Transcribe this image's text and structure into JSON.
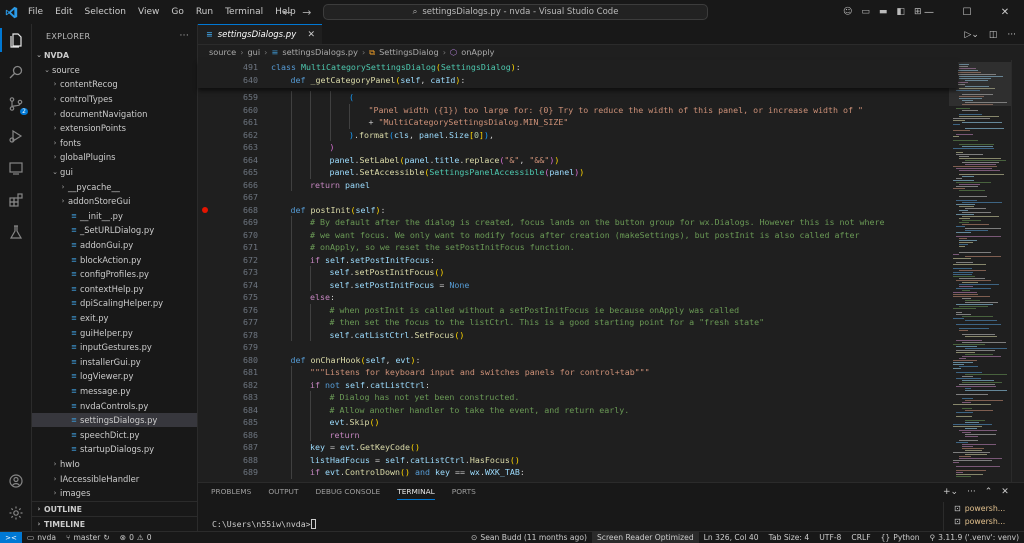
{
  "menu": [
    "File",
    "Edit",
    "Selection",
    "View",
    "Go",
    "Run",
    "Terminal",
    "Help"
  ],
  "search": {
    "text": "settingsDialogs.py - nvda - Visual Studio Code"
  },
  "explorer": {
    "title": "EXPLORER",
    "root": "NVDA",
    "items": [
      {
        "label": "source",
        "indent": 1,
        "type": "folder",
        "open": true
      },
      {
        "label": "contentRecog",
        "indent": 2,
        "type": "folder"
      },
      {
        "label": "controlTypes",
        "indent": 2,
        "type": "folder"
      },
      {
        "label": "documentNavigation",
        "indent": 2,
        "type": "folder"
      },
      {
        "label": "extensionPoints",
        "indent": 2,
        "type": "folder"
      },
      {
        "label": "fonts",
        "indent": 2,
        "type": "folder"
      },
      {
        "label": "globalPlugins",
        "indent": 2,
        "type": "folder"
      },
      {
        "label": "gui",
        "indent": 2,
        "type": "folder",
        "open": true
      },
      {
        "label": "__pycache__",
        "indent": 3,
        "type": "folder"
      },
      {
        "label": "addonStoreGui",
        "indent": 3,
        "type": "folder"
      },
      {
        "label": "__init__.py",
        "indent": 3,
        "type": "py"
      },
      {
        "label": "_SetURLDialog.py",
        "indent": 3,
        "type": "py"
      },
      {
        "label": "addonGui.py",
        "indent": 3,
        "type": "py"
      },
      {
        "label": "blockAction.py",
        "indent": 3,
        "type": "py"
      },
      {
        "label": "configProfiles.py",
        "indent": 3,
        "type": "py"
      },
      {
        "label": "contextHelp.py",
        "indent": 3,
        "type": "py"
      },
      {
        "label": "dpiScalingHelper.py",
        "indent": 3,
        "type": "py"
      },
      {
        "label": "exit.py",
        "indent": 3,
        "type": "py"
      },
      {
        "label": "guiHelper.py",
        "indent": 3,
        "type": "py"
      },
      {
        "label": "inputGestures.py",
        "indent": 3,
        "type": "py"
      },
      {
        "label": "installerGui.py",
        "indent": 3,
        "type": "py"
      },
      {
        "label": "logViewer.py",
        "indent": 3,
        "type": "py"
      },
      {
        "label": "message.py",
        "indent": 3,
        "type": "py"
      },
      {
        "label": "nvdaControls.py",
        "indent": 3,
        "type": "py"
      },
      {
        "label": "settingsDialogs.py",
        "indent": 3,
        "type": "py",
        "selected": true
      },
      {
        "label": "speechDict.py",
        "indent": 3,
        "type": "py"
      },
      {
        "label": "startupDialogs.py",
        "indent": 3,
        "type": "py"
      },
      {
        "label": "hwIo",
        "indent": 2,
        "type": "folder"
      },
      {
        "label": "IAccessibleHandler",
        "indent": 2,
        "type": "folder"
      },
      {
        "label": "images",
        "indent": 2,
        "type": "folder"
      }
    ],
    "outline": "OUTLINE",
    "timeline": "TIMELINE"
  },
  "tab": {
    "label": "settingsDialogs.py"
  },
  "breadcrumb": [
    "source",
    "gui",
    "settingsDialogs.py",
    "SettingsDialog",
    "onApply"
  ],
  "sticky": [
    {
      "n": "491",
      "indent": 0,
      "html": "<span class='kw'>class</span> <span class='cls'>MultiCategorySettingsDialog</span><span class='br1'>(</span><span class='cls'>SettingsDialog</span><span class='br1'>)</span>:"
    },
    {
      "n": "640",
      "indent": 1,
      "html": "<span class='kw'>def</span> <span class='fn'>_getCategoryPanel</span><span class='br1'>(</span><span class='var'>self</span>, <span class='var'>catId</span><span class='br1'>)</span>:"
    }
  ],
  "lines": [
    {
      "n": "659",
      "indent": 4,
      "html": "<span class='br3'>(</span>"
    },
    {
      "n": "660",
      "indent": 5,
      "html": "<span class='str'>\"Panel width ({1}) too large for: {0} Try to reduce the width of this panel, or increase width of \"</span>"
    },
    {
      "n": "661",
      "indent": 5,
      "html": "+ <span class='str'>\"MultiCategorySettingsDialog.MIN_SIZE\"</span>"
    },
    {
      "n": "662",
      "indent": 4,
      "html": "<span class='br3'>)</span>.<span class='fn'>format</span><span class='br3'>(</span><span class='var'>cls</span>, <span class='var'>panel</span>.<span class='var'>Size</span><span class='br1'>[</span><span class='num'>0</span><span class='br1'>]</span><span class='br3'>)</span>,"
    },
    {
      "n": "663",
      "indent": 3,
      "html": "<span class='br2'>)</span>"
    },
    {
      "n": "664",
      "indent": 3,
      "html": "<span class='var'>panel</span>.<span class='fn'>SetLabel</span><span class='br1'>(</span><span class='var'>panel</span>.<span class='var'>title</span>.<span class='fn'>replace</span><span class='br2'>(</span><span class='str'>\"&amp;\"</span>, <span class='str'>\"&amp;&amp;\"</span><span class='br2'>)</span><span class='br1'>)</span>"
    },
    {
      "n": "665",
      "indent": 3,
      "html": "<span class='var'>panel</span>.<span class='fn'>SetAccessible</span><span class='br1'>(</span><span class='cls'>SettingsPanelAccessible</span><span class='br2'>(</span><span class='var'>panel</span><span class='br2'>)</span><span class='br1'>)</span>"
    },
    {
      "n": "666",
      "indent": 2,
      "html": "<span class='ctl'>return</span> <span class='var'>panel</span>"
    },
    {
      "n": "667",
      "indent": 0,
      "html": ""
    },
    {
      "n": "668",
      "indent": 1,
      "bp": true,
      "html": "<span class='kw'>def</span> <span class='fn'>postInit</span><span class='br1'>(</span><span class='var'>self</span><span class='br1'>)</span>:"
    },
    {
      "n": "669",
      "indent": 2,
      "html": "<span class='cm'># By default after the dialog is created, focus lands on the button group for wx.Dialogs. However this is not where</span>"
    },
    {
      "n": "670",
      "indent": 2,
      "html": "<span class='cm'># we want focus. We only want to modify focus after creation (makeSettings), but postInit is also called after</span>"
    },
    {
      "n": "671",
      "indent": 2,
      "html": "<span class='cm'># onApply, so we reset the setPostInitFocus function.</span>"
    },
    {
      "n": "672",
      "indent": 2,
      "html": "<span class='ctl'>if</span> <span class='var'>self</span>.<span class='var'>setPostInitFocus</span>:"
    },
    {
      "n": "673",
      "indent": 3,
      "html": "<span class='var'>self</span>.<span class='fn'>setPostInitFocus</span><span class='br1'>()</span>"
    },
    {
      "n": "674",
      "indent": 3,
      "html": "<span class='var'>self</span>.<span class='var'>setPostInitFocus</span> = <span class='kw'>None</span>"
    },
    {
      "n": "675",
      "indent": 2,
      "html": "<span class='ctl'>else</span>:"
    },
    {
      "n": "676",
      "indent": 3,
      "html": "<span class='cm'># when postInit is called without a setPostInitFocus ie because onApply was called</span>"
    },
    {
      "n": "677",
      "indent": 3,
      "html": "<span class='cm'># then set the focus to the listCtrl. This is a good starting point for a \"fresh state\"</span>"
    },
    {
      "n": "678",
      "indent": 3,
      "html": "<span class='var'>self</span>.<span class='var'>catListCtrl</span>.<span class='fn'>SetFocus</span><span class='br1'>()</span>"
    },
    {
      "n": "679",
      "indent": 0,
      "html": ""
    },
    {
      "n": "680",
      "indent": 1,
      "html": "<span class='kw'>def</span> <span class='fn'>onCharHook</span><span class='br1'>(</span><span class='var'>self</span>, <span class='var'>evt</span><span class='br1'>)</span>:"
    },
    {
      "n": "681",
      "indent": 2,
      "html": "<span class='str'>\"\"\"Listens for keyboard input and switches panels for control+tab\"\"\"</span>"
    },
    {
      "n": "682",
      "indent": 2,
      "html": "<span class='ctl'>if</span> <span class='kw'>not</span> <span class='var'>self</span>.<span class='var'>catListCtrl</span>:"
    },
    {
      "n": "683",
      "indent": 3,
      "html": "<span class='cm'># Dialog has not yet been constructed.</span>"
    },
    {
      "n": "684",
      "indent": 3,
      "html": "<span class='cm'># Allow another handler to take the event, and return early.</span>"
    },
    {
      "n": "685",
      "indent": 3,
      "html": "<span class='var'>evt</span>.<span class='fn'>Skip</span><span class='br1'>()</span>"
    },
    {
      "n": "686",
      "indent": 3,
      "html": "<span class='ctl'>return</span>"
    },
    {
      "n": "687",
      "indent": 2,
      "html": "<span class='var'>key</span> = <span class='var'>evt</span>.<span class='fn'>GetKeyCode</span><span class='br1'>()</span>"
    },
    {
      "n": "688",
      "indent": 2,
      "html": "<span class='var'>listHadFocus</span> = <span class='var'>self</span>.<span class='var'>catListCtrl</span>.<span class='fn'>HasFocus</span><span class='br1'>()</span>"
    },
    {
      "n": "689",
      "indent": 2,
      "html": "<span class='ctl'>if</span> <span class='var'>evt</span>.<span class='fn'>ControlDown</span><span class='br1'>()</span> <span class='kw'>and</span> <span class='var'>key</span> == <span class='var'>wx</span>.<span class='var'>WXK_TAB</span>:"
    }
  ],
  "panel": {
    "tabs": [
      "PROBLEMS",
      "OUTPUT",
      "DEBUG CONSOLE",
      "TERMINAL",
      "PORTS"
    ],
    "active_tab": "TERMINAL",
    "terminal_prompt": "C:\\Users\\n55iw\\nvda>",
    "terminals": [
      "powersh...",
      "powersh..."
    ]
  },
  "status": {
    "workspace": "nvda",
    "branch": "master",
    "errors": "0",
    "warnings": "0",
    "blame": "Sean Budd (11 months ago)",
    "screen_reader": "Screen Reader Optimized",
    "position": "Ln 326, Col 40",
    "tab_size": "Tab Size: 4",
    "encoding": "UTF-8",
    "eol": "CRLF",
    "language": "Python",
    "python": "3.11.9 ('.venv': venv)"
  },
  "colors": {
    "accent": "#0078d4",
    "breakpoint": "#e51400",
    "python_icon": "#3b8fc7"
  }
}
